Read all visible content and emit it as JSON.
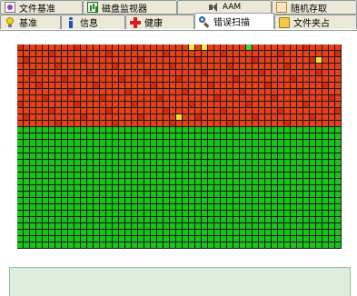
{
  "tabs_row1": [
    {
      "label": "文件基准",
      "icon": "document-icon"
    },
    {
      "label": "磁盘监视器",
      "icon": "chart-icon"
    },
    {
      "label": "AAM",
      "icon": "speaker-icon"
    },
    {
      "label": "随机存取",
      "icon": "random-icon"
    }
  ],
  "tabs_row2": [
    {
      "label": "基准",
      "icon": "bulb-icon"
    },
    {
      "label": "信息",
      "icon": "info-icon"
    },
    {
      "label": "健康",
      "icon": "cross-icon"
    },
    {
      "label": "错误扫描",
      "icon": "magnifier-icon",
      "active": true
    },
    {
      "label": "文件夹占",
      "icon": "folder-icon"
    }
  ],
  "scan_grid": {
    "columns": 51,
    "rows": 32,
    "scanned_rows_red": 13,
    "colors": {
      "damaged": "#e8401a",
      "damaged_alt": "#d42a10",
      "ok": "#19c419",
      "warning_yellow": "#f4e23a",
      "warning_green": "#43d043",
      "grid_line": "#1a1a1a"
    },
    "yellow_cells": [
      [
        0,
        27
      ],
      [
        0,
        29
      ],
      [
        2,
        47
      ],
      [
        11,
        25
      ]
    ],
    "green_cells_in_red": [
      [
        0,
        36
      ]
    ]
  },
  "colors": {
    "tab_bg": "#ece9d8",
    "tab_border": "#919b9c",
    "info_bg": "#dcefdc"
  }
}
